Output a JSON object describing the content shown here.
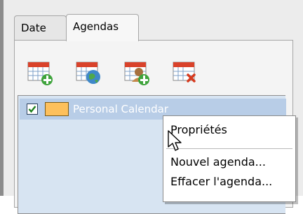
{
  "tabs": [
    {
      "label": "Date",
      "active": false
    },
    {
      "label": "Agendas",
      "active": true
    }
  ],
  "toolbar": {
    "buttons": [
      {
        "icon": "calendar-add-icon"
      },
      {
        "icon": "calendar-globe-icon"
      },
      {
        "icon": "calendar-user-add-icon"
      },
      {
        "icon": "calendar-delete-icon"
      }
    ]
  },
  "calendars": [
    {
      "label": "Personal Calendar",
      "checked": true,
      "color": "#fdc05c",
      "selected": true
    }
  ],
  "context_menu": {
    "items": [
      {
        "label": "Propriétés"
      },
      {
        "label": "Nouvel agenda..."
      },
      {
        "label": "Effacer l'agenda..."
      }
    ]
  },
  "colors": {
    "selection": "#b8cde7",
    "list_background": "#d7e4f2",
    "calendar_swatch": "#fdc05c"
  }
}
